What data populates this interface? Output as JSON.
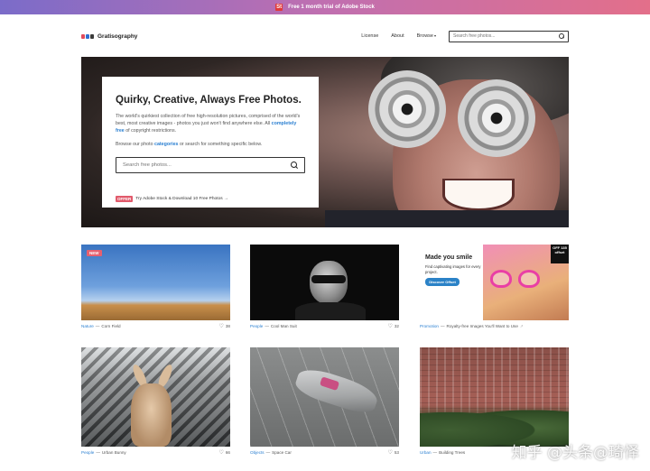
{
  "promo_bar": {
    "icon": "adobe-stock-icon",
    "adobe_glyph": "St",
    "text": "Free 1 month trial of Adobe Stock"
  },
  "header": {
    "logo_text": "Gratisography",
    "logo_colors": [
      "#e04b5c",
      "#2f6fd1",
      "#3b3b3b"
    ],
    "nav": {
      "license": "License",
      "about": "About",
      "browse": "Browse"
    },
    "search_placeholder": "Search free photos..."
  },
  "hero": {
    "title": "Quirky, Creative, Always Free Photos.",
    "desc_before_link": "The world's quirkiest collection of free high-resolution pictures, comprised of the world's best, most creative images - photos you just won't find anywhere else. All ",
    "desc_link": "completely free",
    "desc_after_link": " of copyright restrictions.",
    "browse_before": "Browse our photo ",
    "browse_link": "categories",
    "browse_after": " or search for something specific below.",
    "search_placeholder": "Search free photos...",
    "offer_badge": "OFFER",
    "offer_text": "Try Adobe Stock & Download 10 Free Photos →"
  },
  "cards": [
    {
      "category": "Nature",
      "title": "Corn Field",
      "likes": "38",
      "badge": "NEW"
    },
    {
      "category": "People",
      "title": "Cool Man Suit",
      "likes": "32"
    },
    {
      "category": "Promotion",
      "title": "Royalty-free Images You'll Want to Use",
      "external": "↗",
      "promo": {
        "title": "Made you smile",
        "subtitle": "Find captivating images for every project.",
        "button": "Discover Offset",
        "badge": "OFF 135 offset"
      }
    },
    {
      "category": "People",
      "title": "Urban Bunny",
      "likes": "66"
    },
    {
      "category": "Objects",
      "title": "Space Car",
      "likes": "53"
    },
    {
      "category": "Urban",
      "title": "Building Trees"
    }
  ],
  "watermark": "知乎 @头条@琦怿",
  "colors": {
    "accent_link": "#2a7fd1",
    "badge_red": "#e15a6b",
    "promo_gradient": [
      "#7b6cc9",
      "#e36f8a"
    ]
  }
}
